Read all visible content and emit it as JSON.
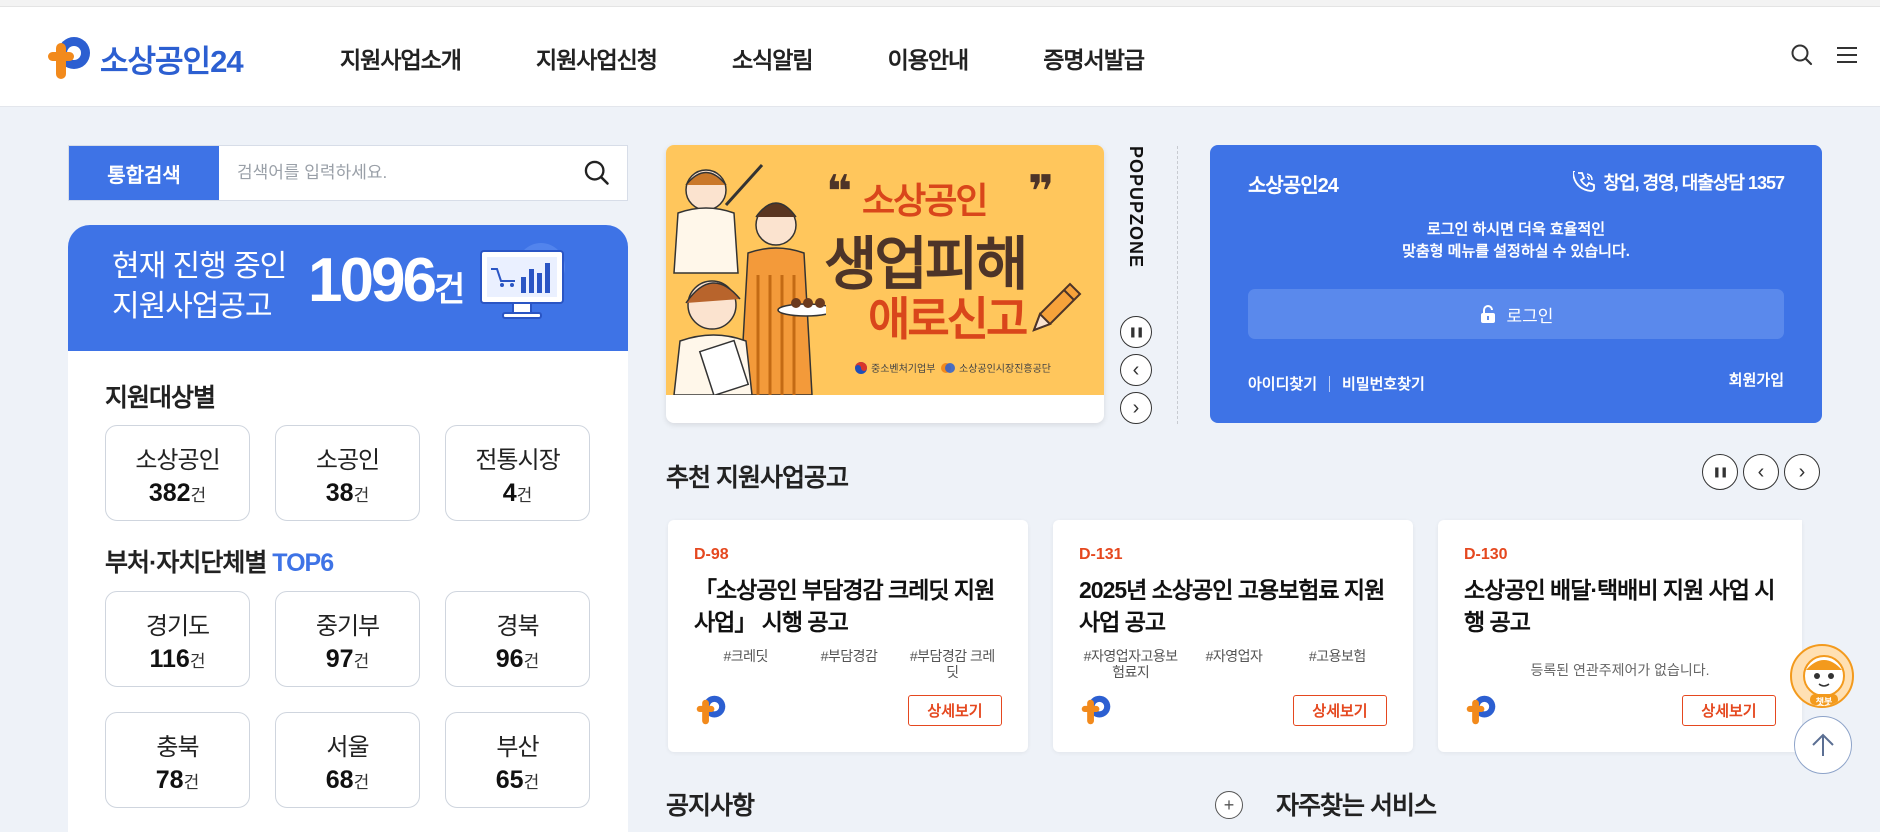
{
  "header": {
    "logo_text": "소상공인24",
    "nav": [
      "지원사업소개",
      "지원사업신청",
      "소식알림",
      "이용안내",
      "증명서발급"
    ]
  },
  "search": {
    "label": "통합검색",
    "placeholder": "검색어를 입력하세요."
  },
  "promo": {
    "label_line1": "현재 진행 중인",
    "label_line2": "지원사업공고",
    "count": "1096",
    "unit": "건"
  },
  "target": {
    "title": "지원대상별",
    "items": [
      {
        "name": "소상공인",
        "count": "382",
        "unit": "건"
      },
      {
        "name": "소공인",
        "count": "38",
        "unit": "건"
      },
      {
        "name": "전통시장",
        "count": "4",
        "unit": "건"
      }
    ]
  },
  "agency": {
    "title": "부처·자치단체별",
    "accent": "TOP6",
    "items": [
      {
        "name": "경기도",
        "count": "116",
        "unit": "건"
      },
      {
        "name": "중기부",
        "count": "97",
        "unit": "건"
      },
      {
        "name": "경북",
        "count": "96",
        "unit": "건"
      },
      {
        "name": "충북",
        "count": "78",
        "unit": "건"
      },
      {
        "name": "서울",
        "count": "68",
        "unit": "건"
      },
      {
        "name": "부산",
        "count": "65",
        "unit": "건"
      }
    ]
  },
  "popup": {
    "zone_label": "POPUPZONE",
    "banner_line1": "소상공인",
    "banner_line2": "생업피해",
    "banner_line3": "애로신고",
    "org1": "중소벤처기업부",
    "org2": "소상공인시장진흥공단",
    "controls": {
      "pause": "❚❚",
      "prev": "‹",
      "next": "›"
    }
  },
  "login": {
    "brand": "소상공인24",
    "phone": "창업, 경영, 대출상담 1357",
    "message_line1": "로그인 하시면 더욱 효율적인",
    "message_line2": "맞춤형 메뉴를 설정하실 수 있습니다.",
    "button": "로그인",
    "find_id": "아이디찾기",
    "find_pw": "비밀번호찾기",
    "join": "회원가입"
  },
  "recommend": {
    "title": "추천 지원사업공고",
    "detail_label": "상세보기",
    "cards": [
      {
        "dday": "D-98",
        "title": "「소상공인 부담경감 크레딧 지원사업」 시행 공고",
        "tags": [
          "#크레딧",
          "#부담경감",
          "#부담경감 크레딧"
        ]
      },
      {
        "dday": "D-131",
        "title": "2025년 소상공인 고용보험료 지원사업 공고",
        "tags": [
          "#자영업자고용보험료지",
          "#자영업자",
          "#고용보험"
        ]
      },
      {
        "dday": "D-130",
        "title": "소상공인 배달·택배비 지원 사업 시행 공고",
        "empty": "등록된 연관주제어가 없습니다."
      }
    ]
  },
  "notice": {
    "title": "공지사항",
    "more": "+"
  },
  "faq": {
    "title": "자주찾는 서비스"
  },
  "chatbot": {
    "label": "챗봇"
  },
  "colors": {
    "primary": "#3e73e6",
    "accent_orange": "#e5481f",
    "logo_orange": "#f28a1c",
    "background": "#eef2f8"
  }
}
